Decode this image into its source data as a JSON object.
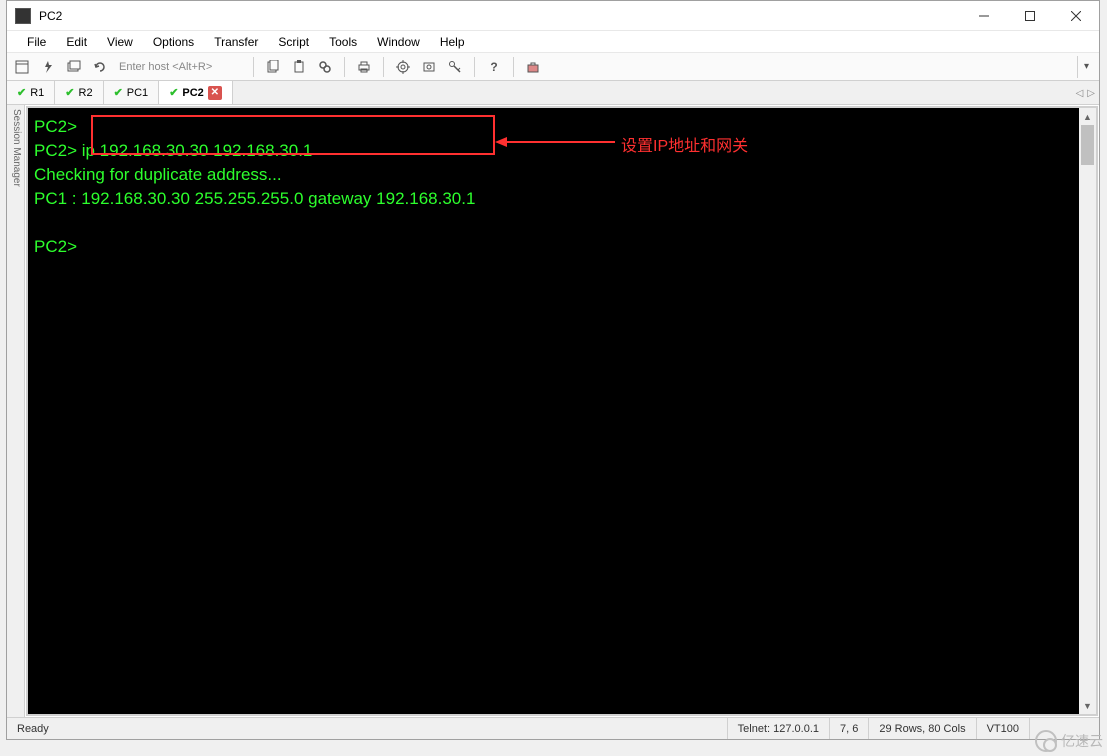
{
  "window": {
    "title": "PC2"
  },
  "menu": {
    "items": [
      "File",
      "Edit",
      "View",
      "Options",
      "Transfer",
      "Script",
      "Tools",
      "Window",
      "Help"
    ]
  },
  "toolbar": {
    "host_placeholder": "Enter host <Alt+R>"
  },
  "tabs": {
    "items": [
      {
        "label": "R1",
        "active": false
      },
      {
        "label": "R2",
        "active": false
      },
      {
        "label": "PC1",
        "active": false
      },
      {
        "label": "PC2",
        "active": true
      }
    ]
  },
  "sidebar": {
    "label": "Session Manager"
  },
  "terminal": {
    "lines": [
      "PC2>",
      "PC2> ip 192.168.30.30 192.168.30.1",
      "Checking for duplicate address...",
      "PC1 : 192.168.30.30 255.255.255.0 gateway 192.168.30.1",
      "",
      "PC2>"
    ]
  },
  "annotation": {
    "text": "设置IP地址和网关"
  },
  "status": {
    "ready": "Ready",
    "proto": "Telnet: 127.0.0.1",
    "cursor": "7,  6",
    "size": "29 Rows, 80 Cols",
    "term": "VT100"
  },
  "watermark": {
    "text": "亿速云"
  }
}
